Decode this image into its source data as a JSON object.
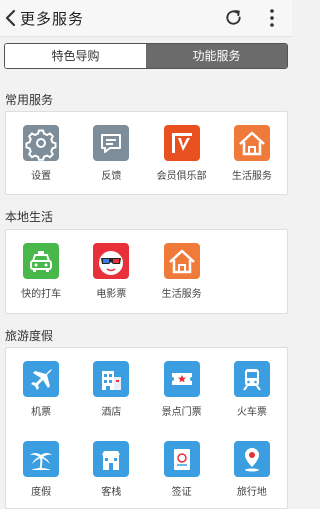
{
  "header": {
    "title": "更多服务"
  },
  "tabs": [
    {
      "label": "特色导购",
      "active": false
    },
    {
      "label": "功能服务",
      "active": true
    }
  ],
  "sections": [
    {
      "title": "常用服务",
      "items": [
        {
          "label": "设置",
          "icon": "gear-icon",
          "color": "#7d8d99"
        },
        {
          "label": "反馈",
          "icon": "chat-bubble-icon",
          "color": "#7d8d99"
        },
        {
          "label": "会员俱乐部",
          "icon": "v-logo-icon",
          "color": "#e8511f"
        },
        {
          "label": "生活服务",
          "icon": "house-icon",
          "color": "#f07a3a"
        }
      ]
    },
    {
      "title": "本地生活",
      "items": [
        {
          "label": "快的打车",
          "icon": "taxi-icon",
          "color": "#49b84a"
        },
        {
          "label": "电影票",
          "icon": "movie-3d-glasses-icon",
          "color": "#e8303a"
        },
        {
          "label": "生活服务",
          "icon": "house-icon",
          "color": "#f07a3a"
        }
      ]
    },
    {
      "title": "旅游度假",
      "items": [
        {
          "label": "机票",
          "icon": "airplane-icon",
          "color": "#3b9ee0"
        },
        {
          "label": "酒店",
          "icon": "hotel-icon",
          "color": "#3b9ee0"
        },
        {
          "label": "景点门票",
          "icon": "ticket-icon",
          "color": "#3b9ee0"
        },
        {
          "label": "火车票",
          "icon": "train-icon",
          "color": "#3b9ee0"
        },
        {
          "label": "度假",
          "icon": "palm-tree-icon",
          "color": "#3b9ee0"
        },
        {
          "label": "客栈",
          "icon": "inn-icon",
          "color": "#3b9ee0"
        },
        {
          "label": "签证",
          "icon": "visa-icon",
          "color": "#3b9ee0"
        },
        {
          "label": "旅行地",
          "icon": "location-pin-icon",
          "color": "#3b9ee0"
        }
      ]
    }
  ]
}
